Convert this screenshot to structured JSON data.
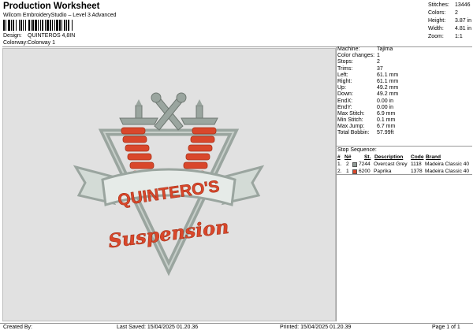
{
  "header": {
    "title": "Production Worksheet",
    "subtitle": "Wilcom EmbroideryStudio – Level 3 Advanced",
    "design_label": "Design:",
    "design_value": "QUINTEROS 4,8IN",
    "colorway_label": "Colorway:",
    "colorway_value": "Colorway 1"
  },
  "stats": [
    {
      "label": "Stitches:",
      "value": "13446"
    },
    {
      "label": "Colors:",
      "value": "2"
    },
    {
      "label": "Height:",
      "value": "3.87 in"
    },
    {
      "label": "Width:",
      "value": "4.81 in"
    },
    {
      "label": "Zoom:",
      "value": "1:1"
    }
  ],
  "info": [
    {
      "label": "Machine:",
      "value": "Tajima"
    },
    {
      "label": "Color changes:",
      "value": "1"
    },
    {
      "label": "Stops:",
      "value": "2"
    },
    {
      "label": "Trims:",
      "value": "37"
    },
    {
      "label": "Left:",
      "value": "61.1 mm"
    },
    {
      "label": "Right:",
      "value": "61.1 mm"
    },
    {
      "label": "Up:",
      "value": "49.2 mm"
    },
    {
      "label": "Down:",
      "value": "49.2 mm"
    },
    {
      "label": "EndX:",
      "value": "0.00 in"
    },
    {
      "label": "EndY:",
      "value": "0.00 in"
    },
    {
      "label": "Max Stitch:",
      "value": "6.9 mm"
    },
    {
      "label": "Min Stitch:",
      "value": "0.1 mm"
    },
    {
      "label": "Max Jump:",
      "value": "6.7 mm"
    },
    {
      "label": "Total Bobbin:",
      "value": "57.99ft"
    }
  ],
  "stop_sequence": {
    "label": "Stop Sequence:",
    "headers": [
      "#",
      "N#",
      "St.",
      "Description",
      "Code",
      "Brand"
    ],
    "rows": [
      {
        "num": "1.",
        "needle": "2",
        "swatch": "#8f9a94",
        "st": "7244",
        "description": "Overcast Grey",
        "code": "1118",
        "brand": "Madeira Classic 40"
      },
      {
        "num": "2.",
        "needle": "1",
        "swatch": "#d9472b",
        "st": "6200",
        "description": "Paprika",
        "code": "1378",
        "brand": "Madeira Classic 40"
      }
    ]
  },
  "design_text": {
    "banner": "QUINTERO'S",
    "script": "Suspension"
  },
  "footer": {
    "created_by": "Created By:",
    "last_saved": "Last Saved: 15/04/2025 01.20.36",
    "printed": "Printed: 15/04/2025 01.20.39",
    "page": "Page 1 of 1"
  },
  "colors": {
    "grey_thread": "#9aa59f",
    "orange_thread": "#d9472b",
    "canvas_bg": "#e1e1e1"
  }
}
